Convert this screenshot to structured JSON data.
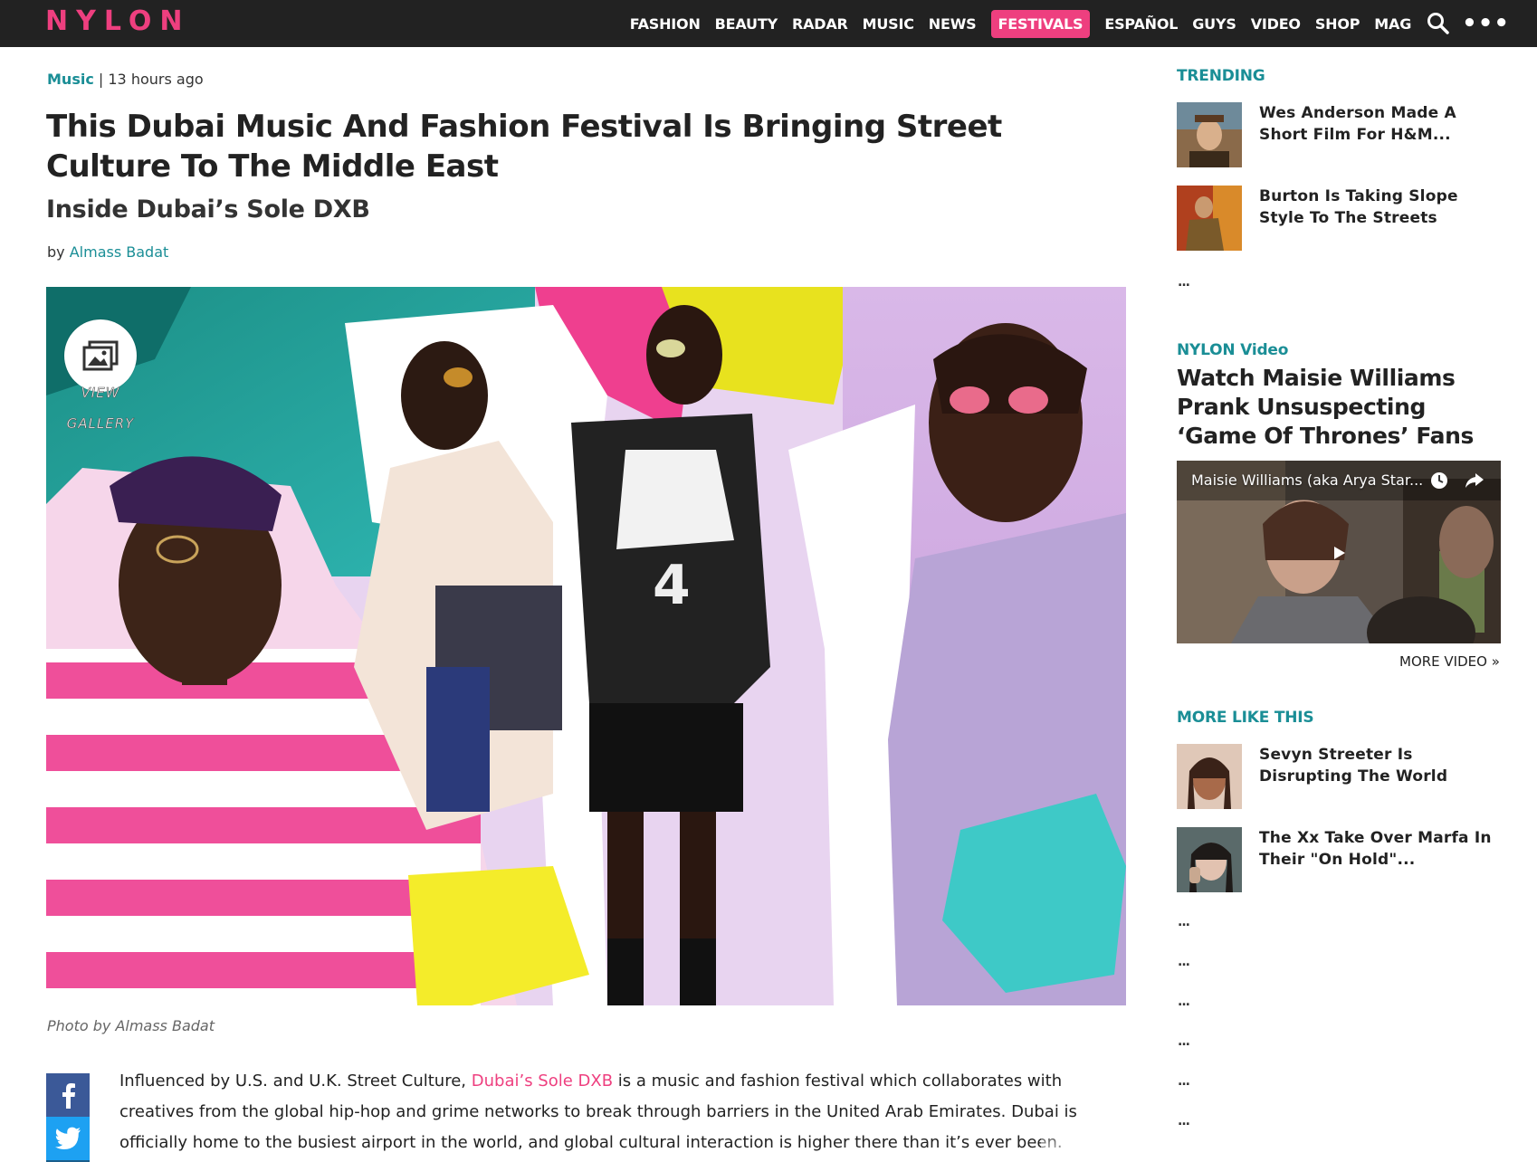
{
  "brand": {
    "logo": "NYLON",
    "accent_color": "#ee3f7f",
    "link_color": "#1a8e96"
  },
  "nav": {
    "items": [
      {
        "label": "FASHION",
        "active": false
      },
      {
        "label": "BEAUTY",
        "active": false
      },
      {
        "label": "RADAR",
        "active": false
      },
      {
        "label": "MUSIC",
        "active": false
      },
      {
        "label": "NEWS",
        "active": false
      },
      {
        "label": "FESTIVALS",
        "active": true
      },
      {
        "label": "ESPAÑOL",
        "active": false
      },
      {
        "label": "GUYS",
        "active": false
      },
      {
        "label": "VIDEO",
        "active": false
      },
      {
        "label": "SHOP",
        "active": false
      },
      {
        "label": "MAG",
        "active": false
      }
    ],
    "search_icon": "search-icon",
    "more_icon": "more-dots-icon",
    "more_label": "•••"
  },
  "article": {
    "category": "Music",
    "separator": " | ",
    "time": "13 hours ago",
    "title": "This Dubai Music And Fashion Festival Is Bringing Street Culture To The Middle East",
    "subtitle": "Inside Dubai’s Sole DXB",
    "byline_prefix": "by ",
    "author": "Almass Badat",
    "gallery_label_1": "VIEW",
    "gallery_label_2": "GALLERY",
    "gallery_icon": "gallery-icon",
    "photo_caption": "Photo by Almass Badat",
    "share": {
      "facebook_icon": "facebook-icon",
      "twitter_icon": "twitter-icon"
    },
    "body_before_link": "Influenced by U.S. and U.K. Street Culture, ",
    "body_link": "Dubai’s Sole DXB",
    "body_after_link": " is a music and fashion festival which collaborates with creatives from the global hip-hop and grime networks to break through barriers in the United Arab Emirates. Dubai is officially home to the busiest airport in the world, and global cultural interaction is higher there than it’s ever been."
  },
  "sidebar": {
    "trending_heading": "TRENDING",
    "trending": [
      {
        "title": "Wes Anderson Made A Short Film For H&M..."
      },
      {
        "title": "Burton Is Taking Slope Style To The Streets"
      }
    ],
    "trending_more": "...",
    "video_heading": "NYLON Video",
    "video_title": "Watch Maisie Williams Prank Unsuspecting ‘Game Of Thrones’ Fans",
    "video_caption": "Maisie Williams (aka Arya Star...",
    "video_icons": [
      "clock-icon",
      "share-icon",
      "play-icon"
    ],
    "more_video": "MORE VIDEO »",
    "more_like_heading": "MORE LIKE THIS",
    "more_like": [
      {
        "title": "Sevyn Streeter Is Disrupting The World"
      },
      {
        "title": "The Xx Take Over Marfa In Their \"On Hold\"..."
      }
    ],
    "more_like_ellipses": [
      "...",
      "...",
      "...",
      "...",
      "...",
      "..."
    ]
  }
}
